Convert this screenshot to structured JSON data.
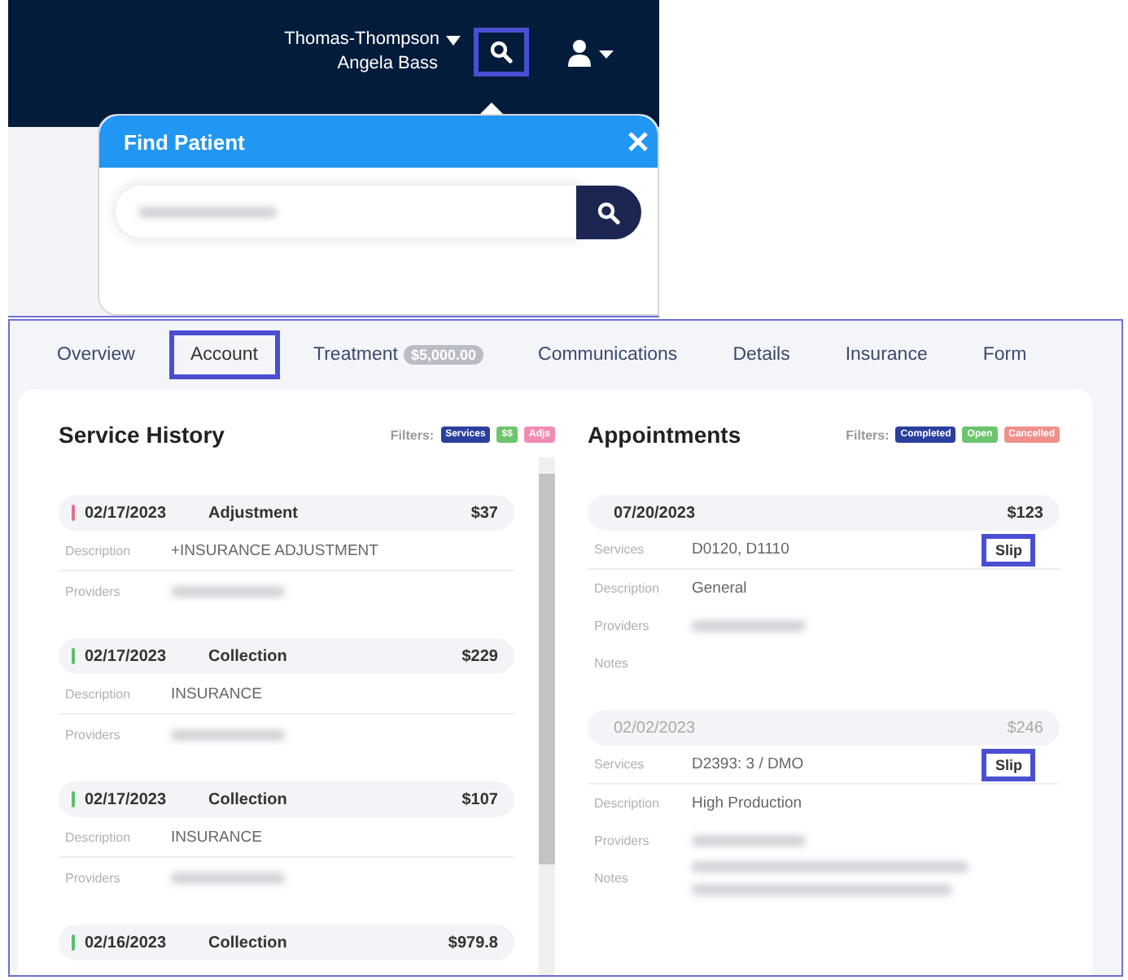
{
  "header": {
    "practice": "Thomas-Thompson",
    "user": "Angela Bass",
    "search_highlighted": true
  },
  "find_patient": {
    "title": "Find Patient"
  },
  "tabs": [
    {
      "label": "Overview",
      "selected": false
    },
    {
      "label": "Account",
      "selected": true
    },
    {
      "label": "Treatment",
      "badge": "$5,000.00",
      "selected": false
    },
    {
      "label": "Communications",
      "selected": false
    },
    {
      "label": "Details",
      "selected": false
    },
    {
      "label": "Insurance",
      "selected": false
    },
    {
      "label": "Form",
      "selected": false
    }
  ],
  "service_history": {
    "title": "Service History",
    "filters_label": "Filters:",
    "filters": [
      {
        "label": "Services",
        "color": "#2b3f9e"
      },
      {
        "label": "$$",
        "color": "#6cc46c"
      },
      {
        "label": "Adjs",
        "color": "#f08cb4"
      }
    ],
    "entries": [
      {
        "date": "02/17/2023",
        "type": "Adjustment",
        "amount": "$37",
        "color": "#e8708f",
        "fields": [
          {
            "label": "Description",
            "kind": "text",
            "value": "+INSURANCE ADJUSTMENT"
          },
          {
            "label": "Providers",
            "kind": "blurred"
          }
        ]
      },
      {
        "date": "02/17/2023",
        "type": "Collection",
        "amount": "$229",
        "color": "#5cbf6a",
        "fields": [
          {
            "label": "Description",
            "kind": "text",
            "value": "INSURANCE"
          },
          {
            "label": "Providers",
            "kind": "blurred"
          }
        ]
      },
      {
        "date": "02/17/2023",
        "type": "Collection",
        "amount": "$107",
        "color": "#5cbf6a",
        "fields": [
          {
            "label": "Description",
            "kind": "text",
            "value": "INSURANCE"
          },
          {
            "label": "Providers",
            "kind": "blurred"
          }
        ]
      },
      {
        "date": "02/16/2023",
        "type": "Collection",
        "amount": "$979.8",
        "color": "#5cbf6a"
      }
    ]
  },
  "appointments": {
    "title": "Appointments",
    "filters_label": "Filters:",
    "filters": [
      {
        "label": "Completed",
        "color": "#2b3f9e"
      },
      {
        "label": "Open",
        "color": "#6cc46c"
      },
      {
        "label": "Cancelled",
        "color": "#f0908c"
      }
    ],
    "entries": [
      {
        "date": "07/20/2023",
        "amount": "$123",
        "dimmed": false,
        "fields": [
          {
            "label": "Services",
            "kind": "text",
            "value": "D0120, D1110",
            "action": "Slip"
          },
          {
            "label": "Description",
            "kind": "text",
            "value": "General"
          },
          {
            "label": "Providers",
            "kind": "blurred"
          },
          {
            "label": "Notes",
            "kind": "empty"
          }
        ]
      },
      {
        "date": "02/02/2023",
        "amount": "$246",
        "dimmed": true,
        "fields": [
          {
            "label": "Services",
            "kind": "text",
            "value": "D2393: 3 / DMO",
            "action": "Slip"
          },
          {
            "label": "Description",
            "kind": "text",
            "value": "High Production"
          },
          {
            "label": "Providers",
            "kind": "blurred"
          },
          {
            "label": "Notes",
            "kind": "blurred2"
          }
        ]
      }
    ]
  }
}
